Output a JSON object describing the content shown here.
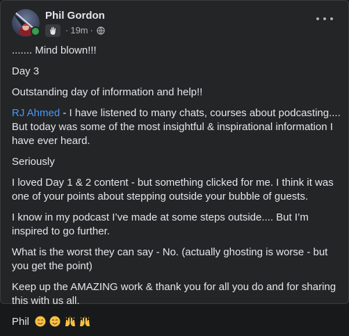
{
  "post": {
    "author": "Phil Gordon",
    "time": "19m",
    "separator": "·",
    "badge_icon": "waving-hand-icon",
    "audience_icon": "globe-icon",
    "menu_icon": "more-options-icon",
    "paragraphs": {
      "p1": "....... Mind blown!!!",
      "p2": "Day 3",
      "p3": "Outstanding day of information and help!!",
      "p4_mention": "RJ Ahmed",
      "p4_text": " - I have listened to many chats, courses about podcasting.... But today was some of the most insightful & inspirational information I have ever heard.",
      "p5": "Seriously",
      "p6": "I loved Day 1 & 2 content - but something clicked for me. I think it was one of your points about stepping outside your bubble of guests.",
      "p7": "I know in my podcast I’ve made at some steps outside.... But I’m inspired to go further.",
      "p8": "What is the worst they can say - No. (actually ghosting is worse - but you get the point)",
      "p9": "Keep up the AMAZING work & thank you for all you do and for sharing this with us all.",
      "p10": "Phil"
    },
    "signoff_emojis": [
      "smiling-face-icon",
      "smiling-face-icon",
      "raising-hands-icon",
      "raising-hands-icon"
    ],
    "colors": {
      "background": "#242526",
      "text": "#e4e6eb",
      "secondary_text": "#b0b3b8",
      "mention": "#4599ff",
      "online": "#31a24c"
    }
  }
}
